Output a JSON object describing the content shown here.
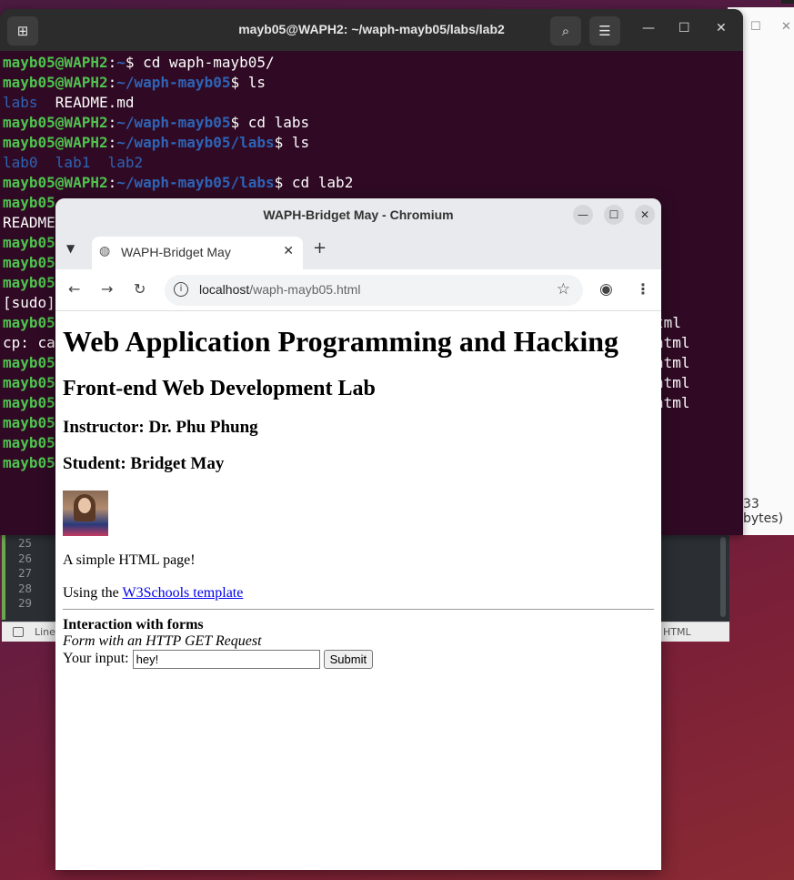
{
  "terminal": {
    "title": "mayb05@WAPH2: ~/waph-mayb05/labs/lab2",
    "lines": [
      {
        "user": "mayb05@WAPH2",
        "path": "~",
        "cmd": "cd waph-mayb05/"
      },
      {
        "user": "mayb05@WAPH2",
        "path": "~/waph-mayb05",
        "cmd": "ls"
      },
      {
        "out_dir": "labs",
        "out": "  README.md"
      },
      {
        "user": "mayb05@WAPH2",
        "path": "~/waph-mayb05",
        "cmd": "cd labs"
      },
      {
        "user": "mayb05@WAPH2",
        "path": "~/waph-mayb05/labs",
        "cmd": "ls"
      },
      {
        "out_dir": "lab0  lab1  lab2"
      },
      {
        "user": "mayb05@WAPH2",
        "path": "~/waph-mayb05/labs",
        "cmd": "cd lab2"
      },
      {
        "partial": "mayb05"
      },
      {
        "partial_plain": "README"
      },
      {
        "partial": "mayb05"
      },
      {
        "partial": "mayb05"
      },
      {
        "partial": "mayb05"
      },
      {
        "partial_plain": "[sudo]"
      },
      {
        "partial": "mayb05"
      },
      {
        "partial_plain": "cp: ca"
      },
      {
        "partial": "mayb05"
      },
      {
        "partial": "mayb05"
      },
      {
        "partial": "mayb05"
      },
      {
        "partial": "mayb05"
      },
      {
        "partial": "mayb05"
      },
      {
        "partial": "mayb05"
      }
    ],
    "right_fragments": [
      "tml",
      "",
      "ntml",
      "ntml",
      "ntml",
      "ntml"
    ]
  },
  "back_window": {
    "bytes_text": "33 bytes)"
  },
  "editor": {
    "line_numbers": [
      "25",
      "26",
      "27",
      "28",
      "29"
    ],
    "status_left": "Line",
    "status_lang": "HTML"
  },
  "browser": {
    "window_title": "WAPH-Bridget May - Chromium",
    "tab_label": "WAPH-Bridget May",
    "url_host": "localhost",
    "url_path": "/waph-mayb05.html"
  },
  "page": {
    "h1": "Web Application Programming and Hacking",
    "h2": "Front-end Web Development Lab",
    "instructor": "Instructor: Dr. Phu Phung",
    "student": "Student: Bridget May",
    "simple": "A simple HTML page!",
    "using_prefix": "Using the ",
    "link_text": "W3Schools template",
    "form_title": "Interaction with forms",
    "form_subtitle": "Form with an HTTP GET Request",
    "input_label": "Your input: ",
    "input_value": "hey!",
    "submit_label": "Submit"
  }
}
